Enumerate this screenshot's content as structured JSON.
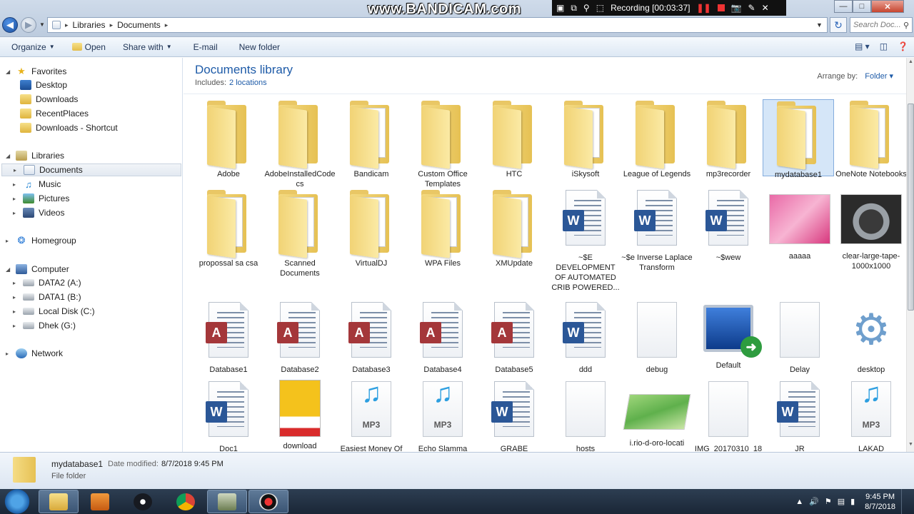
{
  "window": {
    "address": [
      "Libraries",
      "Documents"
    ],
    "search_placeholder": "Search Doc..."
  },
  "bandicam": {
    "watermark": "www.BANDICAM.com",
    "recording": "Recording [00:03:37]"
  },
  "toolbar": {
    "organize": "Organize",
    "open": "Open",
    "share_with": "Share with",
    "email": "E-mail",
    "new_folder": "New folder"
  },
  "nav": {
    "favorites": "Favorites",
    "desktop": "Desktop",
    "downloads": "Downloads",
    "recentplaces": "RecentPlaces",
    "downloads_shortcut": "Downloads - Shortcut",
    "libraries": "Libraries",
    "documents": "Documents",
    "music": "Music",
    "pictures": "Pictures",
    "videos": "Videos",
    "homegroup": "Homegroup",
    "computer": "Computer",
    "drive_a": "DATA2 (A:)",
    "drive_b": "DATA1 (B:)",
    "drive_c": "Local Disk (C:)",
    "drive_g": "Dhek (G:)",
    "network": "Network"
  },
  "library": {
    "title": "Documents library",
    "includes_label": "Includes:",
    "includes_link": "2 locations",
    "arrange_label": "Arrange by:",
    "arrange_value": "Folder"
  },
  "items": {
    "adobe": "Adobe",
    "adobeinstalled": "AdobeInstalledCodecs",
    "bandicam": "Bandicam",
    "custom_office": "Custom Office Templates",
    "htc": "HTC",
    "iskysoft": "iSkysoft",
    "league": "League of Legends",
    "mp3recorder": "mp3recorder",
    "mydatabase1": "mydatabase1",
    "onenote": "OneNote Notebooks",
    "proposal": "propossal sa csa",
    "scanned": "Scanned Documents",
    "virtualdj": "VirtualDJ",
    "wpa": "WPA Files",
    "xmupdate": "XMUpdate",
    "development": "~$E DEVELOPMENT OF AUTOMATED CRIB POWERED...",
    "inverse": "~$e Inverse Laplace Transform",
    "wew": "~$wew",
    "aaaaa": "aaaaa",
    "tape": "clear-large-tape-1000x1000",
    "db1": "Database1",
    "db2": "Database2",
    "db3": "Database3",
    "db4": "Database4",
    "db5": "Database5",
    "ddd": "ddd",
    "debug": "debug",
    "default": "Default",
    "delay": "Delay",
    "desktop": "desktop",
    "doc1": "Doc1",
    "download": "download",
    "easiest": "Easiest Money Of",
    "echo": "Echo Slamma",
    "grabe": "GRABE",
    "hosts": "hosts",
    "rio": "i.rio-d-oro-locati",
    "img": "IMG_20170310_18",
    "jr": "JR",
    "lakad": "LAKAD"
  },
  "details": {
    "name": "mydatabase1",
    "date_label": "Date modified:",
    "date_value": "8/7/2018 9:45 PM",
    "type": "File folder"
  },
  "taskbar": {
    "time": "9:45 PM",
    "date": "8/7/2018"
  }
}
